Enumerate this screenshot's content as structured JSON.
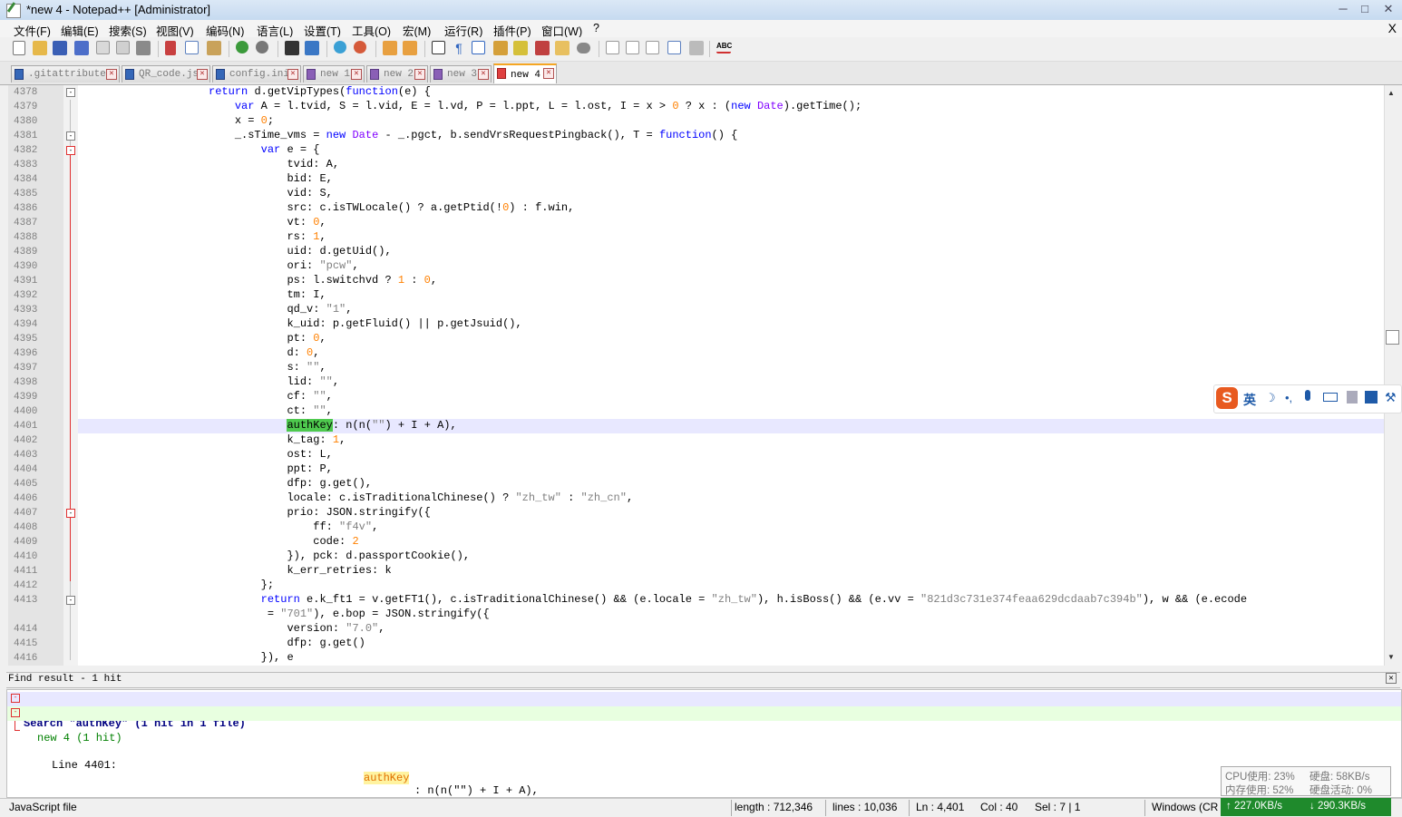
{
  "window": {
    "title": "*new 4 - Notepad++ [Administrator]",
    "minimize": "─",
    "maximize": "□",
    "close": "✕"
  },
  "menu": {
    "items": [
      "文件(F)",
      "编辑(E)",
      "搜索(S)",
      "视图(V)",
      "编码(N)",
      "语言(L)",
      "设置(T)",
      "工具(O)",
      "宏(M)",
      "运行(R)",
      "插件(P)",
      "窗口(W)",
      "?"
    ],
    "close": "X"
  },
  "tabs": [
    {
      "label": ".gitattributes",
      "icon": "file-icon"
    },
    {
      "label": "QR_code.js",
      "icon": "file-icon"
    },
    {
      "label": "config.ini",
      "icon": "file-icon"
    },
    {
      "label": "new 1",
      "icon": "modified-file-icon"
    },
    {
      "label": "new 2",
      "icon": "modified-file-icon"
    },
    {
      "label": "new 3",
      "icon": "modified-file-icon"
    },
    {
      "label": "new 4",
      "icon": "unsaved-file-icon"
    }
  ],
  "editor": {
    "line_numbers": [
      "4378",
      "4379",
      "4380",
      "4381",
      "4382",
      "4383",
      "4384",
      "4385",
      "4386",
      "4387",
      "4388",
      "4389",
      "4390",
      "4391",
      "4392",
      "4393",
      "4394",
      "4395",
      "4396",
      "4397",
      "4398",
      "4399",
      "4400",
      "4401",
      "4402",
      "4403",
      "4404",
      "4405",
      "4406",
      "4407",
      "4408",
      "4409",
      "4410",
      "4411",
      "4412",
      "4413",
      "",
      "4414",
      "4415",
      "4416"
    ],
    "current_line": "4401",
    "search_term": "authKey"
  },
  "find_panel": {
    "header": "Find result - 1 hit",
    "close": "✕",
    "search_line": "Search \"authKey\" (1 hit in 1 file)",
    "file_line": "new 4 (1 hit)",
    "hit_prefix": "Line 4401:",
    "hit_match": "authKey",
    "hit_rest": ": n(n(\"\") + I + A),"
  },
  "statusbar": {
    "file_type": "JavaScript file",
    "length": "length : 712,346",
    "lines": "lines : 10,036",
    "ln": "Ln : 4,401",
    "col": "Col : 40",
    "sel": "Sel : 7 | 1",
    "eol": "Windows (CR"
  },
  "system_monitor": {
    "cpu": "CPU使用: 23%",
    "disk": "硬盘: 58KB/s",
    "memory": "内存使用: 52%",
    "disk_activity": "硬盘活动: 0%",
    "upload": "↑ 227.0KB/s",
    "download": "↓ 290.3KB/s"
  },
  "ime": {
    "mode_label": "英"
  },
  "colors": {
    "keyword": "#0000ff",
    "number": "#ff8000",
    "string": "#808080",
    "highlight": "#4ec94e",
    "current_line": "#e8e8ff",
    "active_tab_accent": "#f5a623"
  }
}
